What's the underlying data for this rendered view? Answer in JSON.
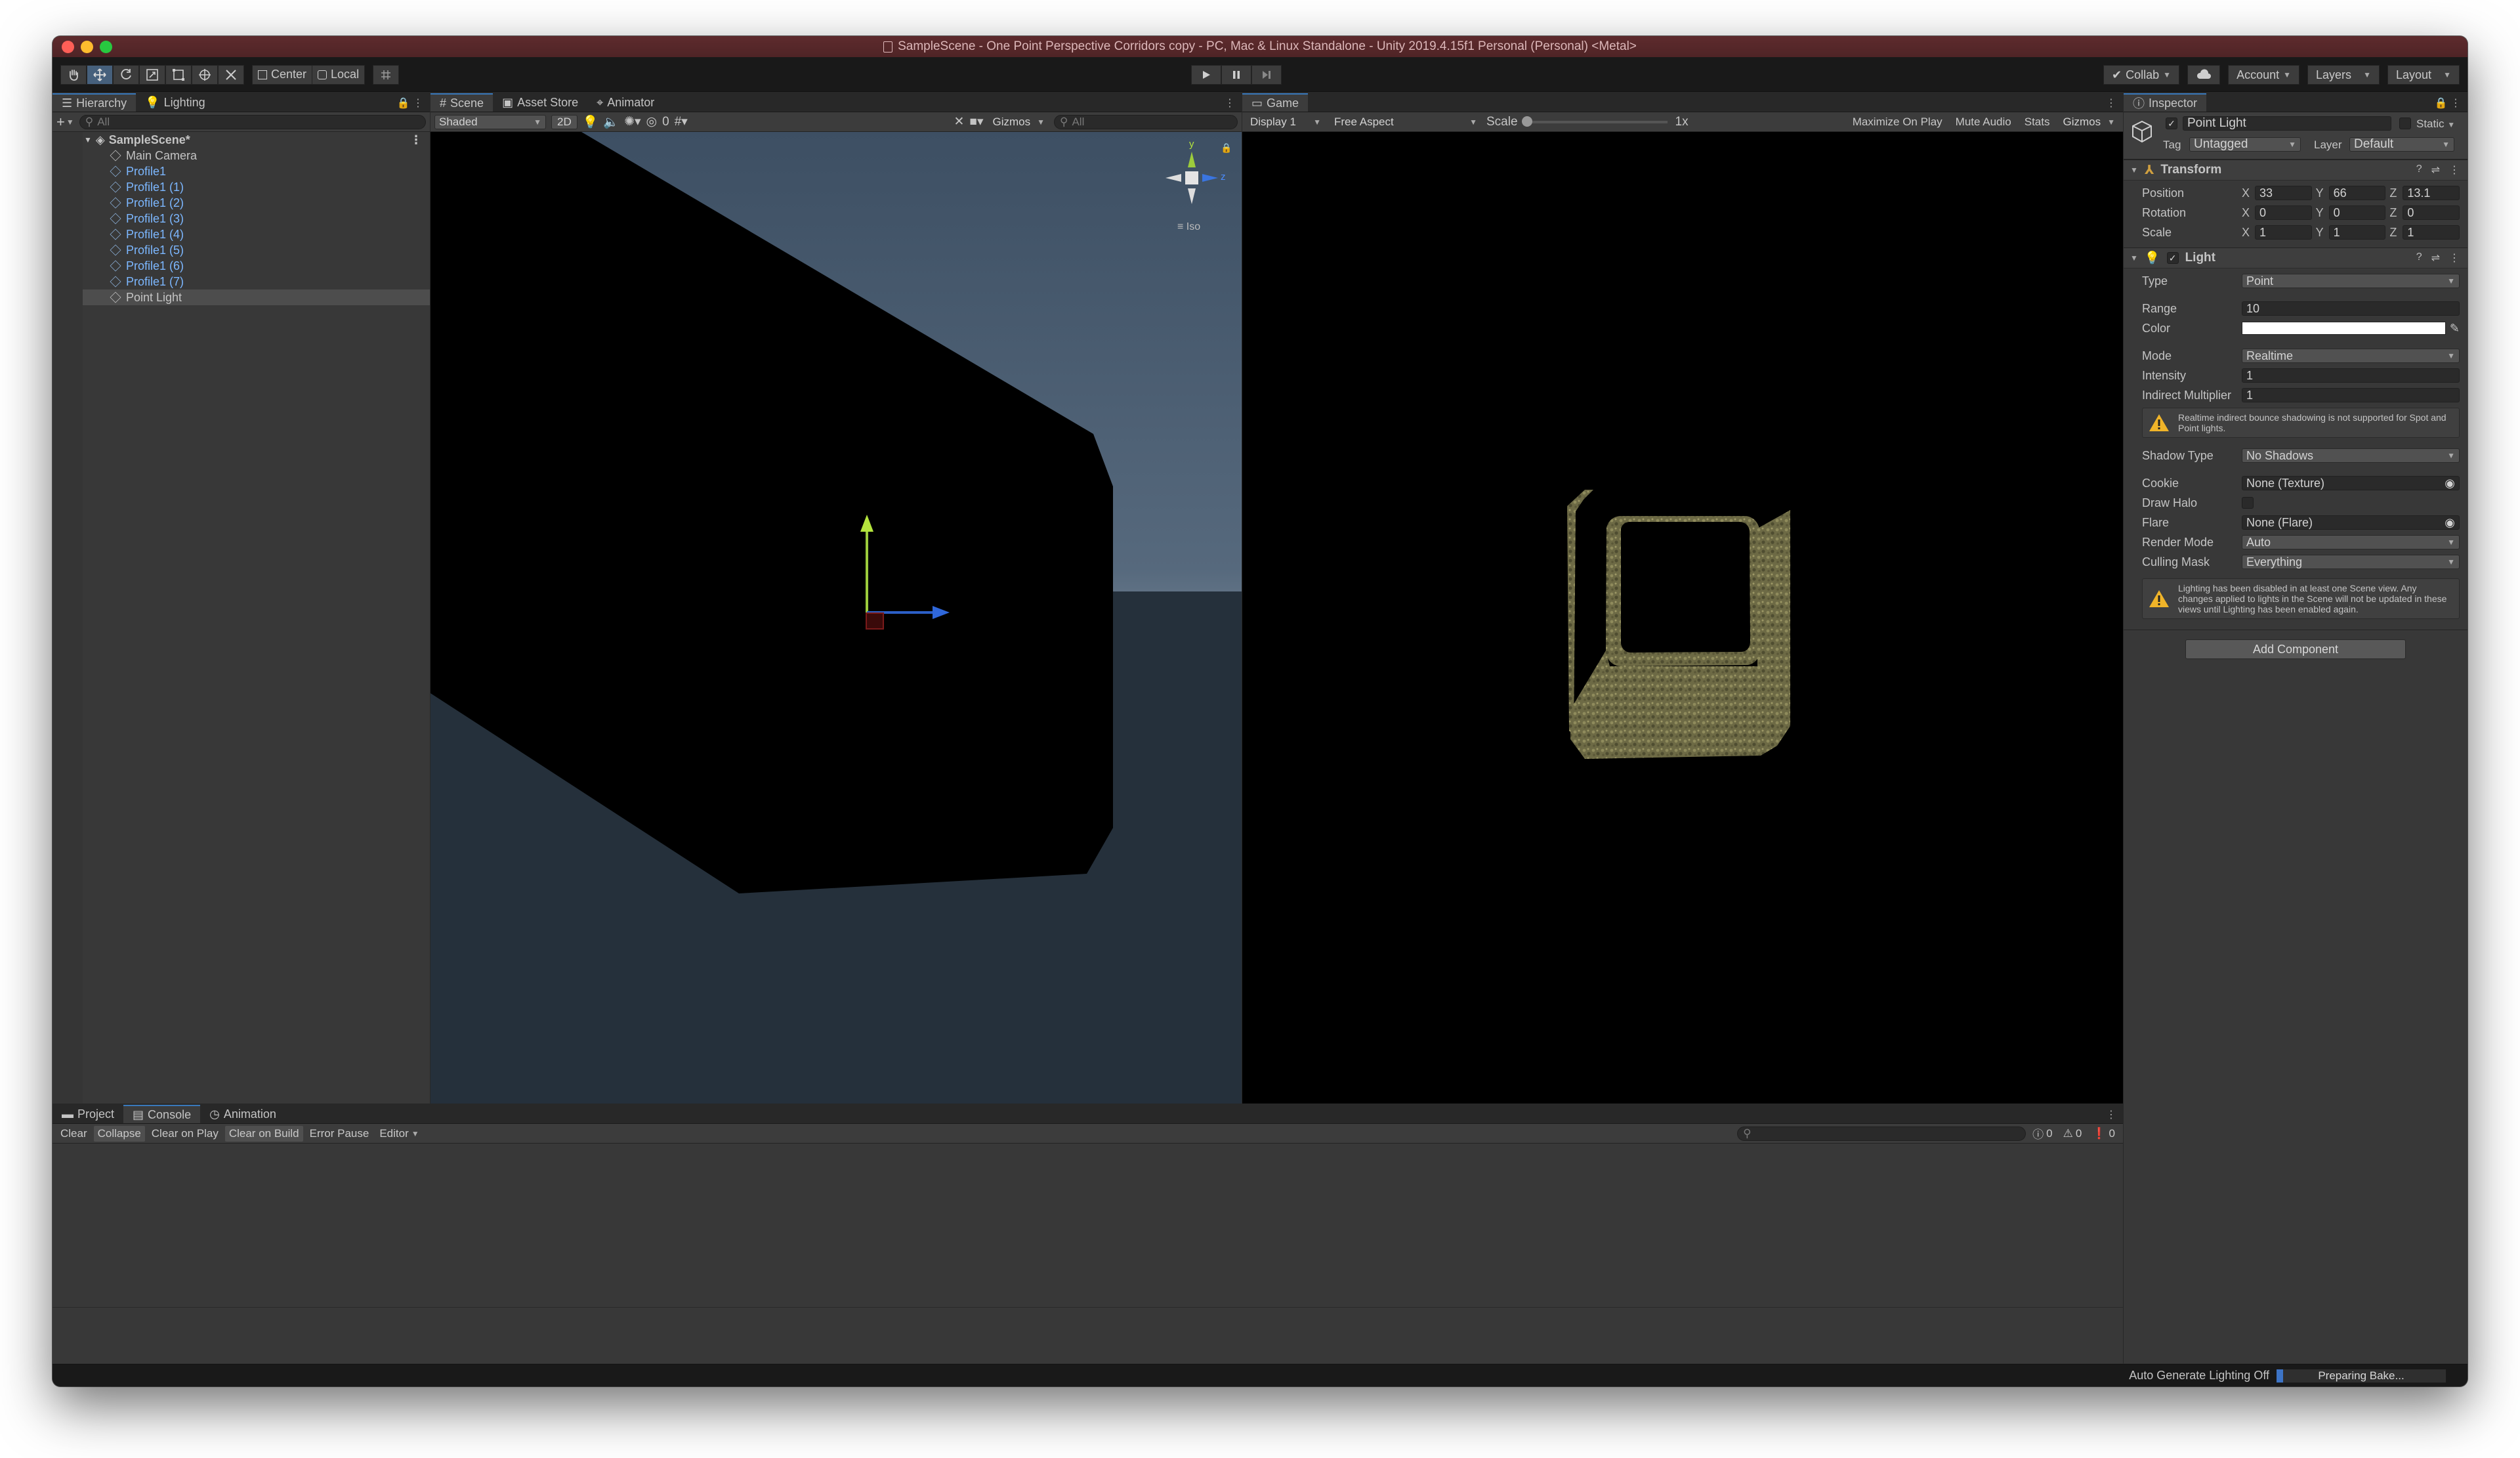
{
  "window": {
    "title": "SampleScene - One Point Perspective Corridors copy - PC, Mac & Linux Standalone - Unity 2019.4.15f1 Personal (Personal) <Metal>"
  },
  "toolbar": {
    "pivot_center": "Center",
    "pivot_local": "Local",
    "collab": "Collab",
    "account": "Account",
    "layers": "Layers",
    "layout": "Layout"
  },
  "hierarchy": {
    "tabs": [
      "Hierarchy",
      "Lighting"
    ],
    "add_label": "+",
    "search_placeholder": "All",
    "scene_name": "SampleScene*",
    "items": [
      {
        "label": "Main Camera",
        "prefab": false
      },
      {
        "label": "Profile1",
        "prefab": true
      },
      {
        "label": "Profile1 (1)",
        "prefab": true
      },
      {
        "label": "Profile1 (2)",
        "prefab": true
      },
      {
        "label": "Profile1 (3)",
        "prefab": true
      },
      {
        "label": "Profile1 (4)",
        "prefab": true
      },
      {
        "label": "Profile1 (5)",
        "prefab": true
      },
      {
        "label": "Profile1 (6)",
        "prefab": true
      },
      {
        "label": "Profile1 (7)",
        "prefab": true
      },
      {
        "label": "Point Light",
        "prefab": false,
        "selected": true
      }
    ]
  },
  "scene": {
    "tabs": [
      "Scene",
      "Asset Store",
      "Animator"
    ],
    "shading_mode": "Shaded",
    "mode_2d": "2D",
    "hidden_count": "0",
    "gizmos": "Gizmos",
    "search_placeholder": "All",
    "gizmo_y": "y",
    "gizmo_z": "z",
    "projection": "Iso"
  },
  "game": {
    "tab": "Game",
    "display": "Display 1",
    "aspect": "Free Aspect",
    "scale_label": "Scale",
    "scale_value": "1x",
    "maximize": "Maximize On Play",
    "mute": "Mute Audio",
    "stats": "Stats",
    "gizmos": "Gizmos"
  },
  "inspector": {
    "tab": "Inspector",
    "object_name": "Point Light",
    "static_label": "Static",
    "tag_label": "Tag",
    "tag_value": "Untagged",
    "layer_label": "Layer",
    "layer_value": "Default",
    "transform": {
      "title": "Transform",
      "position_label": "Position",
      "rotation_label": "Rotation",
      "scale_label": "Scale",
      "position": {
        "x": "33",
        "y": "66",
        "z": "13.1"
      },
      "rotation": {
        "x": "0",
        "y": "0",
        "z": "0"
      },
      "scale": {
        "x": "1",
        "y": "1",
        "z": "1"
      }
    },
    "light": {
      "title": "Light",
      "type_label": "Type",
      "type_value": "Point",
      "range_label": "Range",
      "range_value": "10",
      "color_label": "Color",
      "color_value": "#ffffff",
      "mode_label": "Mode",
      "mode_value": "Realtime",
      "intensity_label": "Intensity",
      "intensity_value": "1",
      "indirect_label": "Indirect Multiplier",
      "indirect_value": "1",
      "warning1": "Realtime indirect bounce shadowing is not supported for Spot and Point lights.",
      "shadow_label": "Shadow Type",
      "shadow_value": "No Shadows",
      "cookie_label": "Cookie",
      "cookie_value": "None (Texture)",
      "halo_label": "Draw Halo",
      "flare_label": "Flare",
      "flare_value": "None (Flare)",
      "render_label": "Render Mode",
      "render_value": "Auto",
      "culling_label": "Culling Mask",
      "culling_value": "Everything",
      "warning2": "Lighting has been disabled in at least one Scene view. Any changes applied to lights in the Scene will not be updated in these views until Lighting has been enabled again."
    },
    "add_component": "Add Component"
  },
  "bottom": {
    "tabs": [
      "Project",
      "Console",
      "Animation"
    ],
    "buttons": [
      {
        "label": "Clear",
        "on": false
      },
      {
        "label": "Collapse",
        "on": true
      },
      {
        "label": "Clear on Play",
        "on": false
      },
      {
        "label": "Clear on Build",
        "on": true
      },
      {
        "label": "Error Pause",
        "on": false
      }
    ],
    "editor_dd": "Editor",
    "log_count": "0",
    "warn_count": "0",
    "error_count": "0"
  },
  "status": {
    "lighting": "Auto Generate Lighting Off",
    "bake_text": "Preparing Bake...",
    "bake_progress": 0.04
  },
  "colors": {
    "accent": "#3a79bb",
    "prefab_text": "#7cb7ff",
    "titlebar": "#5e2b2d"
  }
}
